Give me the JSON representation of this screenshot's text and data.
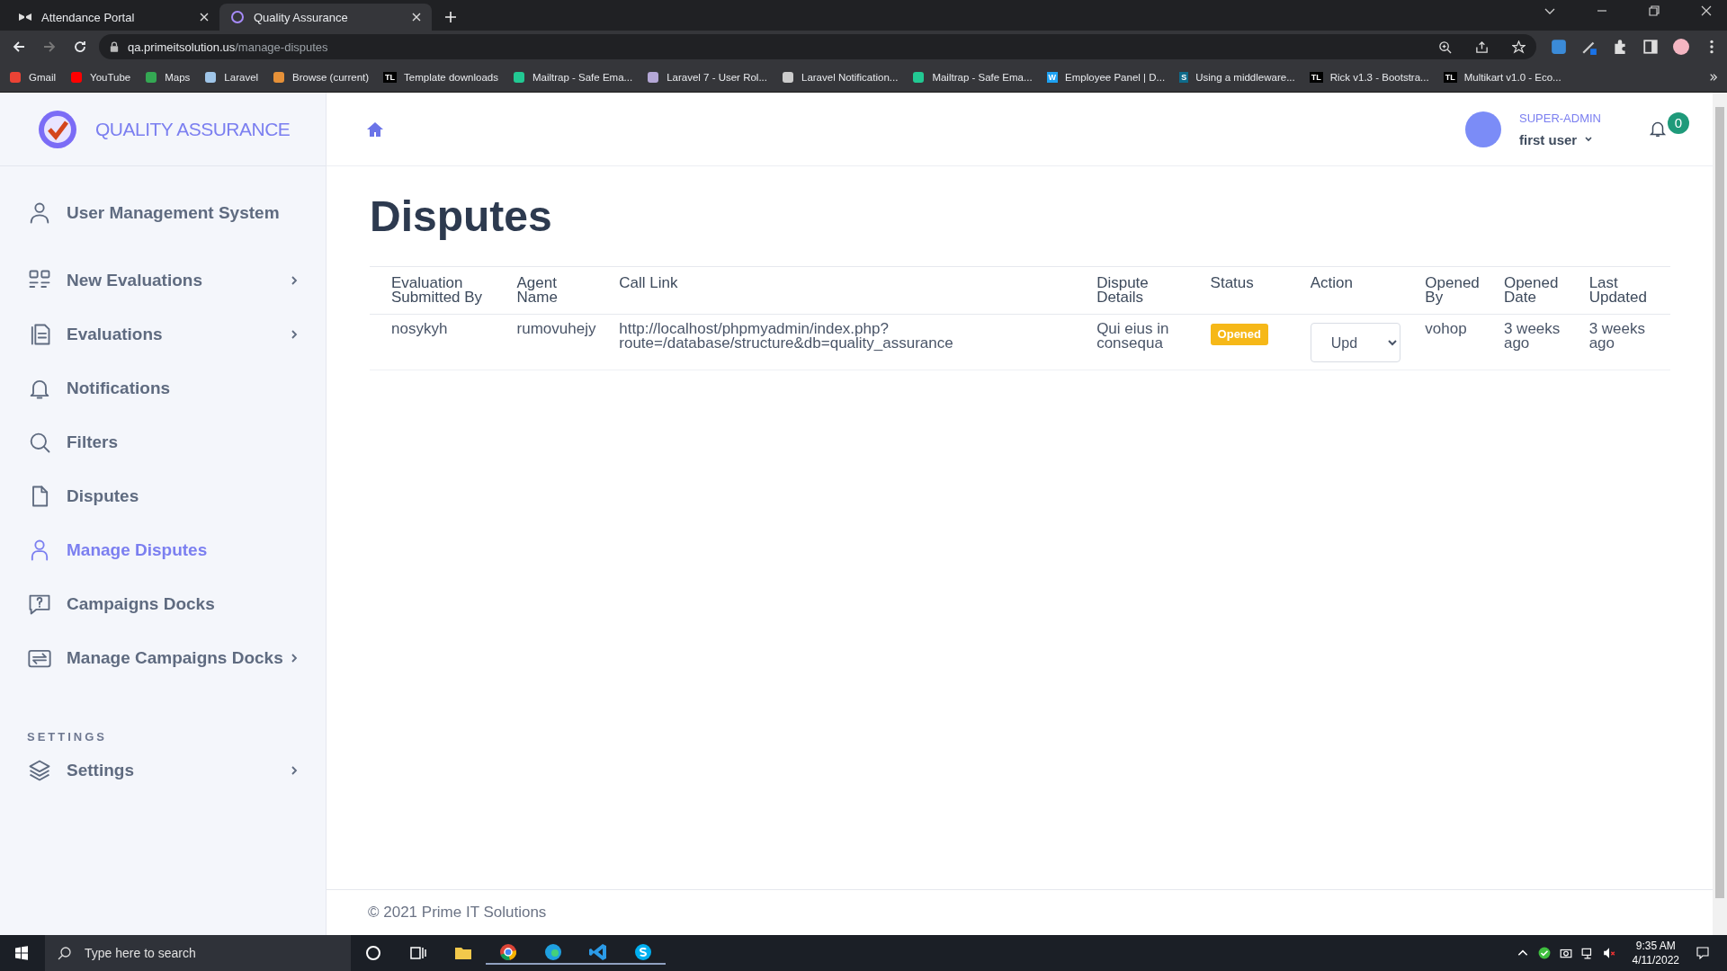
{
  "browser": {
    "tabs": [
      {
        "title": "Attendance Portal",
        "selected": false
      },
      {
        "title": "Quality Assurance",
        "selected": true
      }
    ],
    "address": {
      "host": "qa.primeitsolution.us",
      "path": "/manage-disputes"
    },
    "bookmarks": [
      {
        "label": "Gmail",
        "color": "#ea4335"
      },
      {
        "label": "YouTube",
        "color": "#ff0000"
      },
      {
        "label": "Maps",
        "color": "#34a853"
      },
      {
        "label": "Laravel",
        "color": "#9fc5e8"
      },
      {
        "label": "Browse (current)",
        "color": "#e69138"
      },
      {
        "label": "Template downloads",
        "badge": "TL",
        "color": "#000000"
      },
      {
        "label": "Mailtrap - Safe Ema...",
        "color": "#22c993"
      },
      {
        "label": "Laravel 7 - User Rol...",
        "color": "#b4a7d6"
      },
      {
        "label": "Laravel Notification...",
        "color": "#cccccc"
      },
      {
        "label": "Mailtrap - Safe Ema...",
        "color": "#22c993"
      },
      {
        "label": "Employee Panel | D...",
        "badge": "W",
        "color": "#1da1f2"
      },
      {
        "label": "Using a middleware...",
        "badge": "S",
        "color": "#0e6a8a"
      },
      {
        "label": "Rick v1.3 - Bootstra...",
        "badge": "TL",
        "color": "#000000"
      },
      {
        "label": "Multikart v1.0 - Eco...",
        "badge": "TL",
        "color": "#000000"
      }
    ]
  },
  "app": {
    "brand": "QUALITY ASSURANCE",
    "sidebar": {
      "items": [
        {
          "label": "User Management System",
          "has_submenu": false,
          "selected": false
        },
        {
          "label": "New Evaluations",
          "has_submenu": true,
          "selected": false
        },
        {
          "label": "Evaluations",
          "has_submenu": true,
          "selected": false
        },
        {
          "label": "Notifications",
          "has_submenu": false,
          "selected": false
        },
        {
          "label": "Filters",
          "has_submenu": false,
          "selected": false
        },
        {
          "label": "Disputes",
          "has_submenu": false,
          "selected": false
        },
        {
          "label": "Manage Disputes",
          "has_submenu": false,
          "selected": true
        },
        {
          "label": "Campaigns Docks",
          "has_submenu": false,
          "selected": false
        },
        {
          "label": "Manage Campaigns Docks",
          "has_submenu": true,
          "selected": false
        }
      ],
      "section_label": "SETTINGS",
      "settings_items": [
        {
          "label": "Settings",
          "has_submenu": true,
          "selected": false
        }
      ]
    },
    "user": {
      "role": "SUPER-ADMIN",
      "name": "first user"
    },
    "notifications": {
      "count": "0"
    },
    "page_title": "Disputes",
    "table": {
      "columns": [
        "Evaluation Submitted By",
        "Agent Name",
        "Call Link",
        "Dispute Details",
        "Status",
        "Action",
        "Opened By",
        "Opened Date",
        "Last Updated"
      ],
      "rows": [
        {
          "submitted_by": "nosykyh",
          "agent": "rumovuhejy",
          "call_link": "http://localhost/phpmyadmin/index.php?route=/database/structure&db=quality_assurance",
          "details": "Qui eius in consequa",
          "status": {
            "label": "Opened",
            "kind": "opened"
          },
          "action": "Upd",
          "opened_by": "vohop",
          "opened_date": "3 weeks ago",
          "last_updated": "3 weeks ago"
        }
      ]
    },
    "footer": "© 2021 Prime IT Solutions"
  },
  "taskbar": {
    "search_placeholder": "Type here to search",
    "time": "9:35 AM",
    "date": "4/11/2022"
  }
}
